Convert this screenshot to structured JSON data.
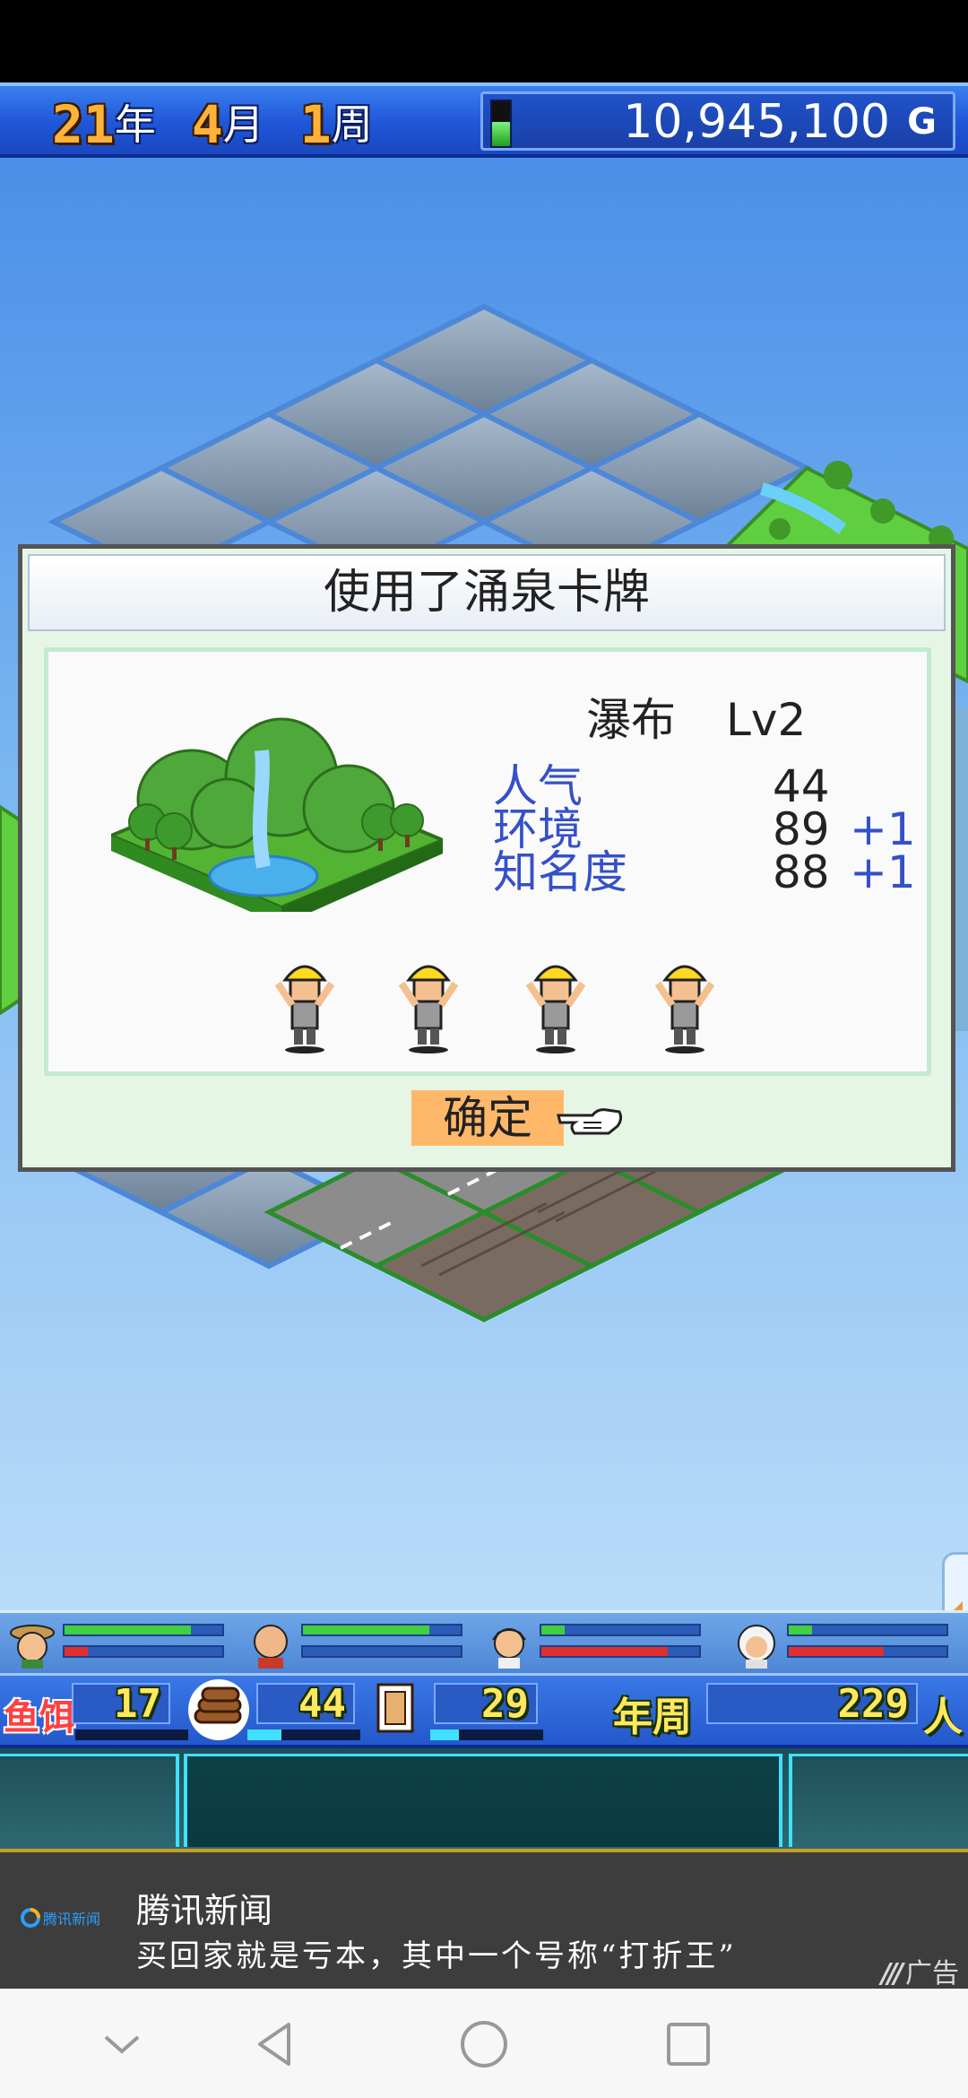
{
  "topbar": {
    "year": "21",
    "year_unit": "年",
    "month": "4",
    "month_unit": "月",
    "week": "1",
    "week_unit": "周",
    "money": "10,945,100",
    "currency": "G",
    "money_meter_fill": 0.55
  },
  "dialog": {
    "title": "使用了涌泉卡牌",
    "facility_name": "瀑布",
    "facility_level": "Lv2",
    "stats": [
      {
        "label": "人气",
        "value": "44",
        "bonus": ""
      },
      {
        "label": "环境",
        "value": "89",
        "bonus": "+1"
      },
      {
        "label": "知名度",
        "value": "88",
        "bonus": "+1"
      }
    ],
    "worker_count": 4,
    "confirm_label": "确定"
  },
  "hud": {
    "staff": [
      {
        "name": "staff-explorer",
        "hp": 0.8,
        "mp": 0.15
      },
      {
        "name": "staff-bald",
        "hp": 0.8,
        "mp": 0.0
      },
      {
        "name": "staff-brown-hair",
        "hp": 0.15,
        "mp": 0.8
      },
      {
        "name": "staff-white-hair",
        "hp": 0.15,
        "mp": 0.6
      }
    ],
    "bait_label": "鱼饵",
    "bait_value": "17",
    "bait_meter": 0.0,
    "wood_value": "44",
    "wood_meter": 0.3,
    "plank_value": "29",
    "plank_meter": 0.25,
    "annual_label": "年周",
    "visitors_value": "229",
    "visitors_unit": "人"
  },
  "ad": {
    "logo_text": "腾讯新闻",
    "title": "腾讯新闻",
    "text": "买回家就是亏本，其中一个号称“打折王”",
    "tag": "广告"
  },
  "colors": {
    "topbar": "#1f56d8",
    "dialog_bg": "#e6f6e4",
    "confirm_bg": "#ffb86a",
    "stat_label": "#3550c8",
    "number_yellow": "#ffe860"
  }
}
